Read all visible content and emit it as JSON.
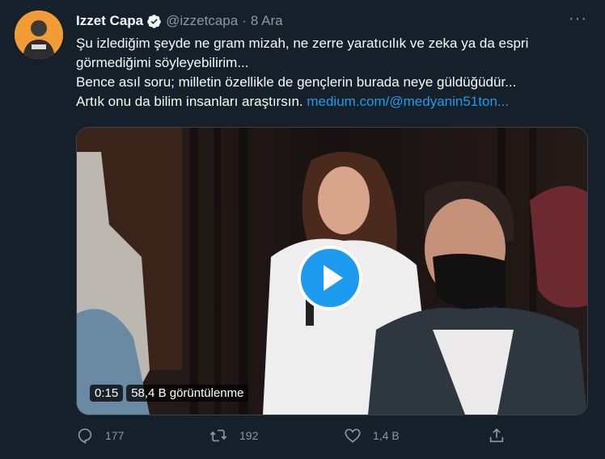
{
  "tweet": {
    "author_name": "Izzet Capa",
    "handle": "@izzetcapa",
    "separator": "·",
    "date": "8 Ara",
    "more_label": "···",
    "text_lines": [
      "Şu izlediğim şeyde ne gram mizah, ne zerre yaratıcılık ve zeka ya da espri",
      "görmediğimi söyleyebilirim...",
      "Bence asıl soru; milletin özellikle de gençlerin burada neye güldüğüdür...",
      "Artık onu da bilim insanları araştırsın."
    ],
    "link": "medium.com/@medyanin51ton...",
    "video": {
      "duration": "0:15",
      "views": "58,4 B görüntülenme"
    },
    "actions": {
      "reply": {
        "icon": "reply-icon",
        "count": "177"
      },
      "retweet": {
        "icon": "retweet-icon",
        "count": "192"
      },
      "like": {
        "icon": "heart-icon",
        "count": "1,4 B"
      },
      "share": {
        "icon": "share-icon",
        "count": ""
      }
    }
  },
  "colors": {
    "background": "#15202b",
    "text": "#f7f9f9",
    "muted": "#8b98a5",
    "accent": "#1d9bf0"
  }
}
